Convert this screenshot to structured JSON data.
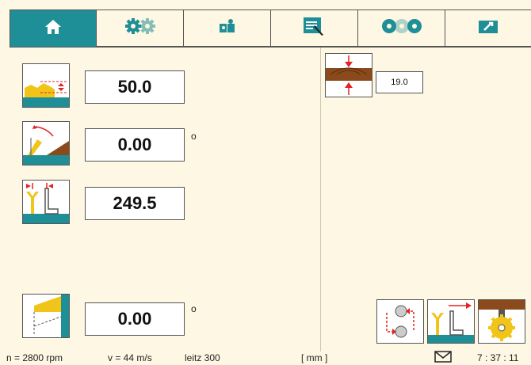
{
  "tabs": [
    {
      "icon": "home-icon",
      "active": true
    },
    {
      "icon": "gears-icon",
      "active": false
    },
    {
      "icon": "puzzle-icon",
      "active": false
    },
    {
      "icon": "list-edit-icon",
      "active": false
    },
    {
      "icon": "saw-blades-icon",
      "active": false
    },
    {
      "icon": "toolbox-icon",
      "active": false
    }
  ],
  "params": {
    "cut_height": {
      "value": "50.0",
      "icon": "cut-height-icon"
    },
    "tilt_angle": {
      "value": "0.00",
      "unit": "o",
      "icon": "tilt-angle-icon"
    },
    "fence_width": {
      "value": "249.5",
      "icon": "fence-width-icon"
    },
    "bevel_angle": {
      "value": "0.00",
      "unit": "o",
      "icon": "bevel-angle-icon"
    }
  },
  "thickness": {
    "value": "19.0",
    "icon": "board-thickness-icon"
  },
  "actions": [
    {
      "icon": "cycle-icon"
    },
    {
      "icon": "fence-move-icon"
    },
    {
      "icon": "saw-blade-icon"
    }
  ],
  "status": {
    "rpm": "n = 2800 rpm",
    "speed": "v = 44 m/s",
    "tool": "leitz  300",
    "units": "[ mm ]",
    "time": "7 : 37 : 11"
  },
  "colors": {
    "accent": "#1e8f96",
    "background": "#fdf7e3",
    "wood": "#8b4a1c",
    "yellow": "#f0c419",
    "red": "#e52222"
  }
}
